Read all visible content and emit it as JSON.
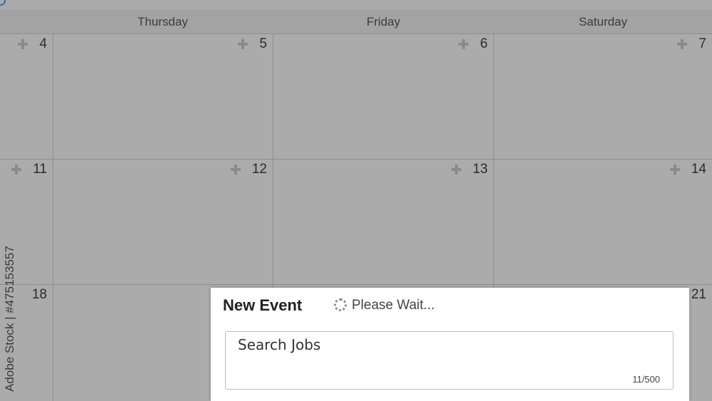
{
  "calendar": {
    "days": [
      "Thursday",
      "Friday",
      "Saturday"
    ],
    "weeks": [
      [
        "4",
        "5",
        "6",
        "7"
      ],
      [
        "11",
        "12",
        "13",
        "14"
      ],
      [
        "18",
        "",
        "",
        "21"
      ]
    ]
  },
  "watermark": {
    "side_text": "Adobe Stock | #475153557"
  },
  "dialog": {
    "title": "New Event",
    "status": "Please Wait...",
    "event_text": "Search Jobs",
    "char_count": "11/500"
  }
}
